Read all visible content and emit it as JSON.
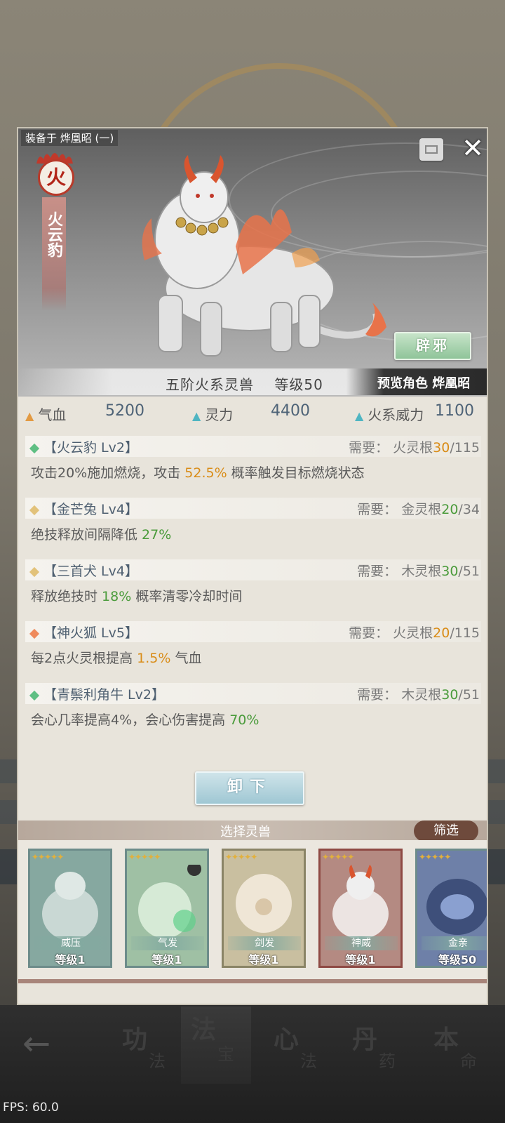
{
  "panel": {
    "equipped_label": "装备于 烨凰昭 (一)",
    "element_char": "火",
    "beast_name": "火云豹",
    "alt_form_button": "辟邪",
    "rank_text": "五阶火系灵兽    等级50",
    "preview_text": "预览角色 烨凰昭"
  },
  "stats": [
    {
      "label": "气血",
      "value": "5200",
      "color": "#e29a43"
    },
    {
      "label": "灵力",
      "value": "4400",
      "color": "#4fb5c2"
    },
    {
      "label": "火系威力",
      "value": "1100",
      "color": "#4fb5c2"
    }
  ],
  "skills": [
    {
      "name": "【火云豹 Lv2】",
      "req_prefix": "需要：",
      "req_root": "火灵根",
      "req_have": "30",
      "req_total": "/115",
      "diamond": "#5fbf83",
      "have_color": "#d98c17",
      "desc": [
        "攻击20%施加燃烧，攻击 ",
        "52.5%",
        " 概率触发目标燃烧状态"
      ],
      "hl": "orange"
    },
    {
      "name": "【金芒兔 Lv4】",
      "req_prefix": "需要：",
      "req_root": "金灵根",
      "req_have": "20",
      "req_total": "/34",
      "diamond": "#e2c27a",
      "have_color": "#4a9b3b",
      "desc": [
        "绝技释放间隔降低 ",
        "27%",
        ""
      ],
      "hl": "green"
    },
    {
      "name": "【三首犬 Lv4】",
      "req_prefix": "需要：",
      "req_root": "木灵根",
      "req_have": "30",
      "req_total": "/51",
      "diamond": "#e2c27a",
      "have_color": "#4a9b3b",
      "desc": [
        "释放绝技时 ",
        "18%",
        " 概率清零冷却时间"
      ],
      "hl": "green"
    },
    {
      "name": "【神火狐 Lv5】",
      "req_prefix": "需要：",
      "req_root": "火灵根",
      "req_have": "20",
      "req_total": "/115",
      "diamond": "#ef8a5c",
      "have_color": "#d98c17",
      "desc": [
        "每2点火灵根提高 ",
        "1.5%",
        " 气血"
      ],
      "hl": "orange"
    },
    {
      "name": "【青鬃利角牛 Lv2】",
      "req_prefix": "需要：",
      "req_root": "木灵根",
      "req_have": "30",
      "req_total": "/51",
      "diamond": "#5fbf83",
      "have_color": "#4a9b3b",
      "desc": [
        "会心几率提高4%，会心伤害提高 ",
        "70%",
        ""
      ],
      "hl": "green"
    }
  ],
  "unequip_button": "卸下",
  "select_title": "选择灵兽",
  "filter_button": "筛选",
  "beast_cards": [
    {
      "tag": "威压",
      "level": "等级1",
      "border": "#6d8c8a",
      "bg": "#86a8a0"
    },
    {
      "tag": "气发",
      "level": "等级1",
      "border": "#6d8c8a",
      "bg": "#9fc0a4"
    },
    {
      "tag": "剑发",
      "level": "等级1",
      "border": "#8a8466",
      "bg": "#c9bfa0"
    },
    {
      "tag": "神威",
      "level": "等级1",
      "border": "#8e4a44",
      "bg": "#b48a82"
    },
    {
      "tag": "金亲",
      "level": "等级50",
      "border": "#6d8c8a",
      "bg": "#6e80a8"
    }
  ],
  "bottom_nav": [
    {
      "big": "功",
      "small": "法"
    },
    {
      "big": "法",
      "small": "宝"
    },
    {
      "big": "心",
      "small": "法"
    },
    {
      "big": "丹",
      "small": "药"
    },
    {
      "big": "本",
      "small": "命"
    }
  ],
  "fps": "FPS: 60.0"
}
